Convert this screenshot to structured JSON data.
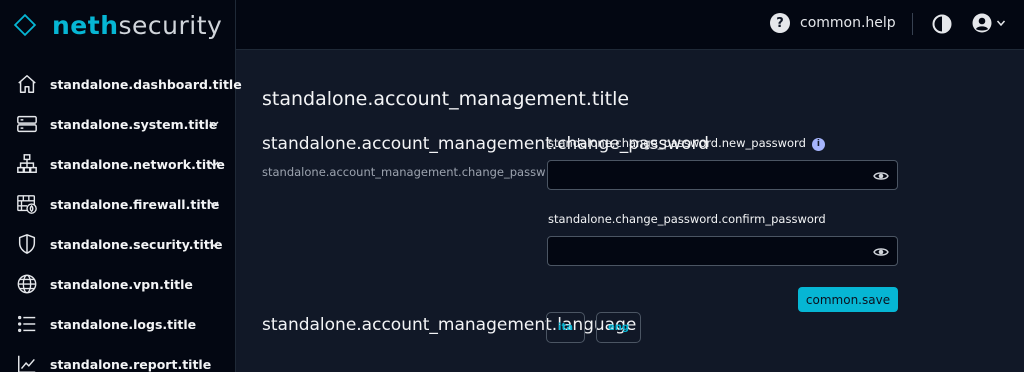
{
  "brand": {
    "part1": "neth",
    "part2": "security"
  },
  "sidebar": {
    "items": [
      {
        "label": "standalone.dashboard.title",
        "icon": "home-icon",
        "has_submenu": false
      },
      {
        "label": "standalone.system.title",
        "icon": "server-icon",
        "has_submenu": true
      },
      {
        "label": "standalone.network.title",
        "icon": "network-icon",
        "has_submenu": true
      },
      {
        "label": "standalone.firewall.title",
        "icon": "firewall-icon",
        "has_submenu": true
      },
      {
        "label": "standalone.security.title",
        "icon": "shield-icon",
        "has_submenu": true
      },
      {
        "label": "standalone.vpn.title",
        "icon": "globe-icon",
        "has_submenu": false
      },
      {
        "label": "standalone.logs.title",
        "icon": "list-icon",
        "has_submenu": false
      },
      {
        "label": "standalone.report.title",
        "icon": "chart-line-icon",
        "has_submenu": false
      }
    ]
  },
  "topbar": {
    "help_label": "common.help",
    "help_icon": "question-circle-icon",
    "theme_icon": "contrast-icon",
    "account_icon": "user-circle-icon"
  },
  "main": {
    "page_title": "standalone.account_management.title",
    "section_title": "standalone.account_management.change_password",
    "section_description": "standalone.account_management.change_password_description",
    "new_password_label": "standalone.change_password.new_password",
    "new_password_value": "",
    "confirm_password_label": "standalone.change_password.confirm_password",
    "confirm_password_value": "",
    "save_label": "common.save",
    "language_title": "standalone.account_management.language",
    "languages": [
      "ita",
      "eng"
    ]
  },
  "colors": {
    "accent": "#06b6d4",
    "sidebar_bg": "#030712",
    "main_bg": "#111827",
    "info": "#a5b4fc"
  }
}
